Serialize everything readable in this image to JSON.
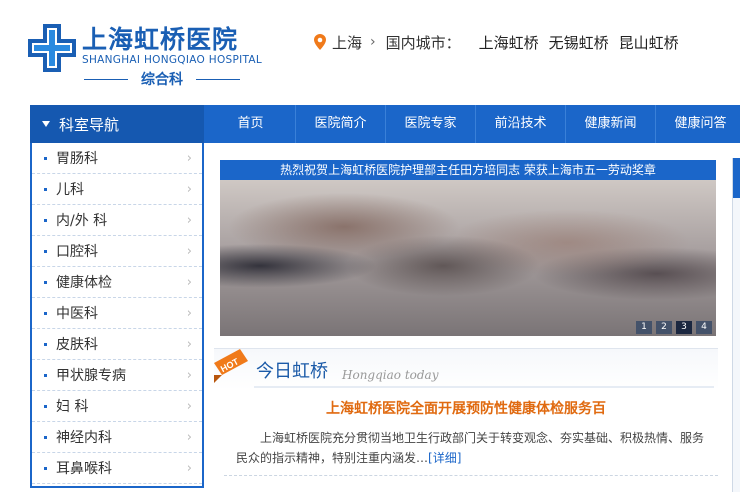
{
  "logo": {
    "title": "上海虹桥医院",
    "english": "SHANGHAI HONGQIAO HOSPITAL",
    "subtitle": "综合科"
  },
  "city_bar": {
    "current_city": "上海",
    "chevron": "›",
    "label": "国内城市：",
    "cities": [
      "上海虹桥",
      "无锡虹桥",
      "昆山虹桥"
    ]
  },
  "nav": {
    "sidebar_title": "科室导航",
    "items": [
      "首页",
      "医院简介",
      "医院专家",
      "前沿技术",
      "健康新闻",
      "健康问答"
    ]
  },
  "sidebar": {
    "items": [
      "胃肠科",
      "儿科",
      "内/外 科",
      "口腔科",
      "健康体检",
      "中医科",
      "皮肤科",
      "甲状腺专病",
      "妇 科",
      "神经内科",
      "耳鼻喉科"
    ],
    "arrow": "›"
  },
  "banner": {
    "caption": "热烈祝贺上海虹桥医院护理部主任田方培同志 荣获上海市五一劳动奖章",
    "pages": [
      "1",
      "2",
      "3",
      "4"
    ],
    "active_page": "3"
  },
  "today": {
    "badge": "HOT",
    "title": "今日虹桥",
    "english": "Hongqiao today",
    "headline": "上海虹桥医院全面开展预防性健康体检服务百",
    "summary": "上海虹桥医院充分贯彻当地卫生行政部门关于转变观念、夯实基础、积极热情、服务民众的指示精神，特别注重内涵发…",
    "more": "[详细]"
  },
  "colors": {
    "brand_blue": "#1b66c9",
    "headline_orange": "#e06a10",
    "hot_badge": "#f07a1a"
  }
}
